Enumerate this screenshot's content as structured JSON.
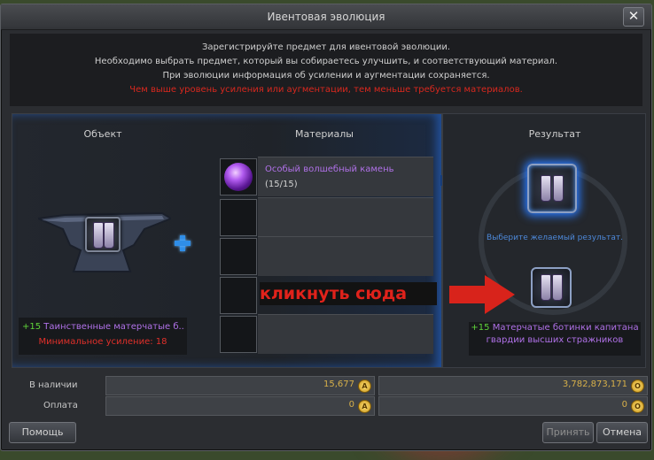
{
  "window": {
    "title": "Ивентовая эволюция",
    "close_glyph": "✕"
  },
  "instructions": {
    "line1": "Зарегистрируйте предмет для ивентовой эволюции.",
    "line2": "Необходимо выбрать предмет, который вы собираетесь улучшить, и соответствующий материал.",
    "line3": "При эволюции информация об усилении и аугментации сохраняется.",
    "warning": "Чем выше уровень усиления или аугментации, тем меньше требуется материалов."
  },
  "object": {
    "header": "Объект",
    "enchant": "+15",
    "name": "Таинственные матерчатые б...",
    "min_enchant": "Минимальное усиление: 18"
  },
  "materials": {
    "header": "Материалы",
    "items": [
      {
        "name": "Особый волшебный камень",
        "count": "(15/15)",
        "icon": "magic-stone-icon"
      },
      {
        "name": "",
        "count": ""
      },
      {
        "name": "",
        "count": ""
      },
      {
        "name": "",
        "count": ""
      },
      {
        "name": "",
        "count": ""
      }
    ]
  },
  "result": {
    "header": "Результат",
    "hint": "Выберите желаемый результат.",
    "enchant": "+15",
    "name": "Матерчатые ботинки капитана гвардии высших стражников"
  },
  "annotation": {
    "text": "кликнуть сюда",
    "color": "#d8231b"
  },
  "funds": {
    "have_label": "В наличии",
    "pay_label": "Оплата",
    "have_adena": "15,677",
    "have_other": "3,782,873,171",
    "pay_adena": "0",
    "pay_other": "0"
  },
  "buttons": {
    "help": "Помощь",
    "accept": "Принять",
    "cancel": "Отмена"
  },
  "colors": {
    "accent_blue": "#2f8ee8",
    "item_purple": "#b071e8",
    "enchant_green": "#5fd33a",
    "warning_red": "#d8281e",
    "gold": "#d7b04a"
  }
}
